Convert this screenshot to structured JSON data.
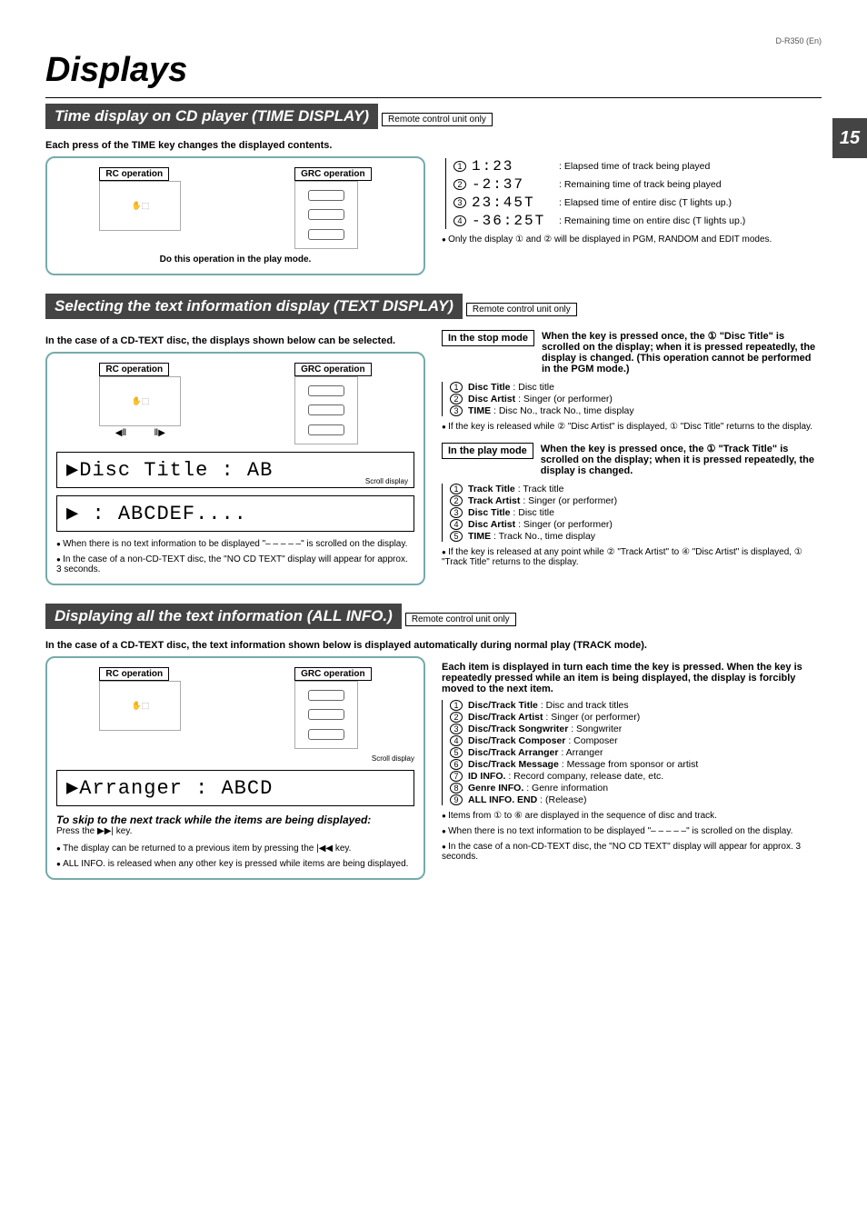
{
  "model_id": "D-R350 (En)",
  "page_number": "15",
  "page_title": "Displays",
  "rc_only_label": "Remote control unit only",
  "rc_op": "RC operation",
  "grc_op": "GRC operation",
  "section1": {
    "title": "Time display on CD player (TIME DISPLAY)",
    "intro": "Each press of the TIME key changes the displayed contents.",
    "panel_caption": "Do this operation in the play mode.",
    "rows": [
      {
        "num": "1",
        "seg": "  1:23",
        "desc": ": Elapsed time of track being played"
      },
      {
        "num": "2",
        "seg": " -2:37",
        "desc": ": Remaining time of track being played"
      },
      {
        "num": "3",
        "seg": " 23:45T",
        "desc": ": Elapsed time of entire disc    (T lights up.)"
      },
      {
        "num": "4",
        "seg": "-36:25T",
        "desc": ": Remaining time on entire disc (T lights up.)"
      }
    ],
    "note": "Only the display ① and ② will be displayed in PGM, RANDOM and EDIT modes."
  },
  "section2": {
    "title": "Selecting the text information display (TEXT DISPLAY)",
    "intro": "In the case of a CD-TEXT disc, the displays shown below can be selected.",
    "lcd1": "▶Disc Title  :  AB",
    "lcd1_sub": "Scroll display",
    "lcd2": "▶ :  ABCDEF....",
    "left_note1": "When there is no text information to be displayed \"– – – – –\" is scrolled on the display.",
    "left_note2": "In the case of a non-CD-TEXT disc, the \"NO CD TEXT\" display will appear for approx. 3 seconds.",
    "stop_mode_label": "In the stop mode",
    "stop_mode_text": "When the key is pressed once, the ① \"Disc Title\" is scrolled on the display; when it is pressed repeatedly, the display is changed. (This operation cannot be performed in the PGM mode.)",
    "stop_rows": [
      {
        "num": "1",
        "label": "Disc Title",
        "val": ": Disc title"
      },
      {
        "num": "2",
        "label": "Disc Artist",
        "val": ": Singer (or performer)"
      },
      {
        "num": "3",
        "label": "TIME",
        "val": ": Disc No., track No., time display"
      }
    ],
    "stop_note": "If the key is released while ② \"Disc Artist\" is displayed, ① \"Disc Title\" returns to the display.",
    "play_mode_label": "In the play mode",
    "play_mode_text": "When the key is pressed once, the ① \"Track Title\" is scrolled on the display; when it is pressed repeatedly, the display is changed.",
    "play_rows": [
      {
        "num": "1",
        "label": "Track Title",
        "val": ": Track title"
      },
      {
        "num": "2",
        "label": "Track Artist",
        "val": ": Singer (or performer)"
      },
      {
        "num": "3",
        "label": "Disc Title",
        "val": ": Disc title"
      },
      {
        "num": "4",
        "label": "Disc Artist",
        "val": ": Singer (or performer)"
      },
      {
        "num": "5",
        "label": "TIME",
        "val": ": Track No., time display"
      }
    ],
    "play_note": "If the key is released at any point while ② \"Track Artist\" to ④ \"Disc Artist\" is displayed, ① \"Track Title\" returns to the display."
  },
  "section3": {
    "title": "Displaying all the text information (ALL INFO.)",
    "intro": "In the case of a CD-TEXT disc, the text information shown below is displayed automatically during normal play (TRACK mode).",
    "lcd_sub": "Scroll display",
    "lcd": "▶Arranger  :  ABCD",
    "skip_title": "To skip to the next track while the items are being displayed:",
    "skip_body": "Press the ▶▶| key.",
    "left_note1": "The display can be returned to a previous item by pressing the |◀◀ key.",
    "left_note2": "ALL INFO. is released when any other key is pressed while items are being displayed.",
    "right_intro": "Each item is displayed in turn each time the key is pressed. When the key is repeatedly pressed while an item is being displayed, the display is forcibly moved to the next item.",
    "rows": [
      {
        "num": "1",
        "label": "Disc/Track Title",
        "val": ": Disc and track titles"
      },
      {
        "num": "2",
        "label": "Disc/Track Artist",
        "val": ": Singer (or performer)"
      },
      {
        "num": "3",
        "label": "Disc/Track Songwriter",
        "val": ": Songwriter"
      },
      {
        "num": "4",
        "label": "Disc/Track Composer",
        "val": ": Composer"
      },
      {
        "num": "5",
        "label": "Disc/Track Arranger",
        "val": ": Arranger"
      },
      {
        "num": "6",
        "label": "Disc/Track Message",
        "val": ": Message from sponsor or artist"
      },
      {
        "num": "7",
        "label": "ID INFO.",
        "val": ": Record company, release date, etc."
      },
      {
        "num": "8",
        "label": "Genre INFO.",
        "val": ": Genre information"
      },
      {
        "num": "9",
        "label": "ALL INFO. END",
        "val": ": (Release)"
      }
    ],
    "right_note1": "Items from ① to ⑥ are displayed in the sequence of disc and track.",
    "right_note2": "When there is no text information to be displayed \"– – – – –\" is scrolled on the display.",
    "right_note3": "In the case of a non-CD-TEXT disc, the \"NO CD TEXT\" display will appear for approx. 3 seconds."
  }
}
